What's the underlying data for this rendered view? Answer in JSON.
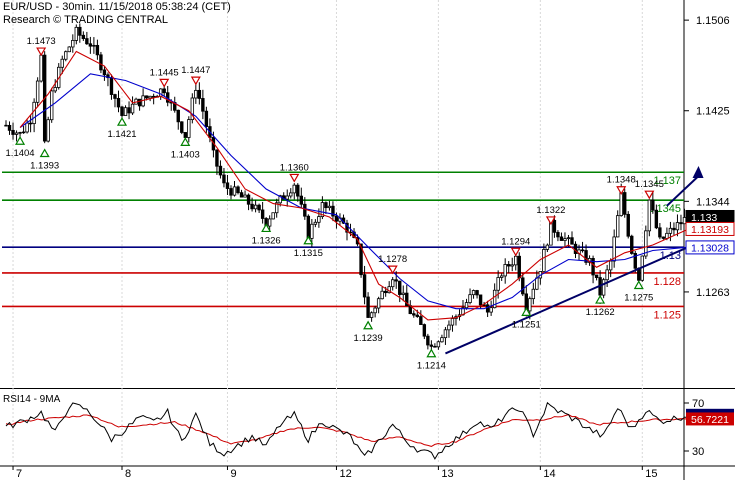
{
  "header": {
    "title": "EUR/USD - 30min. 11/15/2018 05:38:24 (CET)",
    "credit": "Research © TRADING CENTRAL"
  },
  "colors": {
    "price": "#000000",
    "ma_fast": "#cc0000",
    "ma_slow": "#0000cc",
    "resistance": "#008000",
    "pivot": "#000080",
    "support": "#cc0000",
    "trendline": "#000066",
    "rsi": "#000000",
    "rsi_ma": "#cc0000",
    "bullish_marker": "#008000",
    "bearish_marker": "#cc0000"
  },
  "chart_data": [
    {
      "type": "candlestick",
      "x_ticks": [
        {
          "label": "7",
          "idx": 2
        },
        {
          "label": "8",
          "idx": 33
        },
        {
          "label": "9",
          "idx": 63
        },
        {
          "label": "12",
          "idx": 94
        },
        {
          "label": "13",
          "idx": 123
        },
        {
          "label": "14",
          "idx": 152
        },
        {
          "label": "15",
          "idx": 181
        }
      ],
      "y_ticks": [
        1.1506,
        1.1425,
        1.1344,
        1.1263
      ],
      "ylim": [
        1.1178,
        1.1524
      ],
      "n_bars": 190,
      "price_path": [
        [
          0,
          1.1412
        ],
        [
          4,
          1.1404
        ],
        [
          7,
          1.1418
        ],
        [
          10,
          1.1473
        ],
        [
          11,
          1.1393
        ],
        [
          13,
          1.144
        ],
        [
          16,
          1.147
        ],
        [
          20,
          1.1495
        ],
        [
          24,
          1.1485
        ],
        [
          28,
          1.146
        ],
        [
          33,
          1.1421
        ],
        [
          37,
          1.1432
        ],
        [
          41,
          1.1438
        ],
        [
          45,
          1.1445
        ],
        [
          47,
          1.143
        ],
        [
          51,
          1.1403
        ],
        [
          54,
          1.1447
        ],
        [
          56,
          1.1425
        ],
        [
          59,
          1.1385
        ],
        [
          62,
          1.1358
        ],
        [
          66,
          1.135
        ],
        [
          70,
          1.134
        ],
        [
          74,
          1.1326
        ],
        [
          78,
          1.1345
        ],
        [
          82,
          1.136
        ],
        [
          86,
          1.1315
        ],
        [
          90,
          1.134
        ],
        [
          94,
          1.133
        ],
        [
          97,
          1.132
        ],
        [
          100,
          1.1302
        ],
        [
          103,
          1.1239
        ],
        [
          107,
          1.1262
        ],
        [
          110,
          1.1278
        ],
        [
          114,
          1.125
        ],
        [
          118,
          1.1232
        ],
        [
          121,
          1.1214
        ],
        [
          125,
          1.123
        ],
        [
          129,
          1.1245
        ],
        [
          133,
          1.1262
        ],
        [
          137,
          1.1245
        ],
        [
          141,
          1.128
        ],
        [
          145,
          1.1294
        ],
        [
          148,
          1.1251
        ],
        [
          152,
          1.1285
        ],
        [
          155,
          1.1322
        ],
        [
          159,
          1.131
        ],
        [
          163,
          1.1298
        ],
        [
          166,
          1.129
        ],
        [
          169,
          1.1262
        ],
        [
          172,
          1.129
        ],
        [
          175,
          1.1349
        ],
        [
          178,
          1.13
        ],
        [
          180,
          1.1275
        ],
        [
          183,
          1.1345
        ],
        [
          186,
          1.1308
        ],
        [
          190,
          1.132
        ],
        [
          194,
          1.133
        ]
      ],
      "ma_fast": [
        [
          4,
          1.141
        ],
        [
          12,
          1.144
        ],
        [
          20,
          1.1478
        ],
        [
          28,
          1.1465
        ],
        [
          36,
          1.1432
        ],
        [
          44,
          1.1438
        ],
        [
          52,
          1.1425
        ],
        [
          60,
          1.1392
        ],
        [
          68,
          1.1355
        ],
        [
          76,
          1.1342
        ],
        [
          84,
          1.1338
        ],
        [
          92,
          1.133
        ],
        [
          100,
          1.131
        ],
        [
          106,
          1.127
        ],
        [
          112,
          1.1258
        ],
        [
          120,
          1.1238
        ],
        [
          128,
          1.124
        ],
        [
          136,
          1.1252
        ],
        [
          144,
          1.127
        ],
        [
          152,
          1.1292
        ],
        [
          160,
          1.1305
        ],
        [
          168,
          1.1285
        ],
        [
          176,
          1.1298
        ],
        [
          184,
          1.1305
        ],
        [
          194,
          1.1319
        ]
      ],
      "ma_slow": [
        [
          4,
          1.141
        ],
        [
          14,
          1.1432
        ],
        [
          24,
          1.1458
        ],
        [
          34,
          1.1452
        ],
        [
          44,
          1.144
        ],
        [
          54,
          1.142
        ],
        [
          64,
          1.1385
        ],
        [
          74,
          1.1355
        ],
        [
          84,
          1.1338
        ],
        [
          94,
          1.1332
        ],
        [
          104,
          1.13
        ],
        [
          112,
          1.1275
        ],
        [
          120,
          1.1255
        ],
        [
          128,
          1.1248
        ],
        [
          136,
          1.1248
        ],
        [
          144,
          1.1258
        ],
        [
          152,
          1.1278
        ],
        [
          160,
          1.1292
        ],
        [
          168,
          1.129
        ],
        [
          176,
          1.1292
        ],
        [
          184,
          1.13
        ],
        [
          194,
          1.1303
        ]
      ],
      "levels": [
        {
          "value": 1.137,
          "label": "1.137",
          "kind": "resistance"
        },
        {
          "value": 1.1345,
          "label": "1.1345",
          "kind": "resistance"
        },
        {
          "value": 1.1303,
          "label": "1.13",
          "kind": "pivot"
        },
        {
          "value": 1.128,
          "label": "1.128",
          "kind": "support"
        },
        {
          "value": 1.125,
          "label": "1.125",
          "kind": "support"
        }
      ],
      "price_tags": [
        {
          "value": 1.133,
          "label": "1.133",
          "style": "current"
        },
        {
          "value": 1.13193,
          "label": "1.13193",
          "style": "ma_fast"
        },
        {
          "value": 1.13028,
          "label": "1.13028",
          "style": "ma_slow"
        }
      ],
      "swing_labels": [
        {
          "idx": 10,
          "value": 1.1473,
          "label": "1.1473",
          "marker": "bear"
        },
        {
          "idx": 4,
          "value": 1.1404,
          "label": "1.1404",
          "marker": "bull"
        },
        {
          "idx": 11,
          "value": 1.1393,
          "label": "1.1393",
          "marker": "bull"
        },
        {
          "idx": 33,
          "value": 1.1421,
          "label": "1.1421",
          "marker": "bull"
        },
        {
          "idx": 45,
          "value": 1.1445,
          "label": "1.1445",
          "marker": "bear"
        },
        {
          "idx": 54,
          "value": 1.1447,
          "label": "1.1447",
          "marker": "bear"
        },
        {
          "idx": 51,
          "value": 1.1403,
          "label": "1.1403",
          "marker": "bull"
        },
        {
          "idx": 82,
          "value": 1.136,
          "label": "1.1360",
          "marker": "bear"
        },
        {
          "idx": 74,
          "value": 1.1326,
          "label": "1.1326",
          "marker": "bull"
        },
        {
          "idx": 86,
          "value": 1.1315,
          "label": "1.1315",
          "marker": "bull"
        },
        {
          "idx": 110,
          "value": 1.1278,
          "label": "1.1278",
          "marker": "bear"
        },
        {
          "idx": 103,
          "value": 1.1239,
          "label": "1.1239",
          "marker": "bull"
        },
        {
          "idx": 121,
          "value": 1.1214,
          "label": "1.1214",
          "marker": "bull"
        },
        {
          "idx": 145,
          "value": 1.1294,
          "label": "1.1294",
          "marker": "bear"
        },
        {
          "idx": 155,
          "value": 1.1322,
          "label": "1.1322",
          "marker": "bear"
        },
        {
          "idx": 148,
          "value": 1.1251,
          "label": "1.1251",
          "marker": "bull"
        },
        {
          "idx": 175,
          "value": 1.1349,
          "label": "1.1348",
          "marker": "bear"
        },
        {
          "idx": 183,
          "value": 1.1345,
          "label": "1.1345",
          "marker": "bear"
        },
        {
          "idx": 169,
          "value": 1.1262,
          "label": "1.1262",
          "marker": "bull"
        },
        {
          "idx": 180,
          "value": 1.1275,
          "label": "1.1275",
          "marker": "bull"
        }
      ],
      "trendline": [
        [
          125,
          1.1208
        ],
        [
          194,
          1.1303
        ]
      ],
      "forecast_arrow": [
        [
          188,
          1.134
        ],
        [
          197,
          1.1372
        ]
      ]
    },
    {
      "type": "line",
      "title": "RSI14 - 9MA",
      "ylim": [
        20,
        80
      ],
      "y_ticks": [
        30,
        70
      ],
      "tags": [
        {
          "value": 59.7452,
          "label": "59.7452",
          "style": "rsi"
        },
        {
          "value": 56.7221,
          "label": "56.7221",
          "style": "rsi_ma"
        }
      ],
      "rsi": [
        [
          0,
          50
        ],
        [
          5,
          55
        ],
        [
          10,
          62
        ],
        [
          14,
          45
        ],
        [
          18,
          68
        ],
        [
          22,
          66
        ],
        [
          26,
          55
        ],
        [
          30,
          40
        ],
        [
          34,
          48
        ],
        [
          38,
          58
        ],
        [
          42,
          54
        ],
        [
          46,
          62
        ],
        [
          50,
          38
        ],
        [
          54,
          60
        ],
        [
          58,
          36
        ],
        [
          62,
          28
        ],
        [
          66,
          35
        ],
        [
          70,
          42
        ],
        [
          74,
          34
        ],
        [
          78,
          52
        ],
        [
          82,
          60
        ],
        [
          86,
          40
        ],
        [
          90,
          55
        ],
        [
          94,
          48
        ],
        [
          98,
          42
        ],
        [
          102,
          24
        ],
        [
          106,
          38
        ],
        [
          110,
          52
        ],
        [
          114,
          38
        ],
        [
          118,
          30
        ],
        [
          122,
          26
        ],
        [
          126,
          36
        ],
        [
          130,
          44
        ],
        [
          134,
          55
        ],
        [
          138,
          48
        ],
        [
          142,
          60
        ],
        [
          146,
          66
        ],
        [
          150,
          44
        ],
        [
          154,
          68
        ],
        [
          158,
          62
        ],
        [
          162,
          56
        ],
        [
          166,
          48
        ],
        [
          170,
          42
        ],
        [
          174,
          66
        ],
        [
          178,
          48
        ],
        [
          182,
          64
        ],
        [
          186,
          55
        ],
        [
          190,
          57
        ],
        [
          194,
          60
        ]
      ],
      "rsi_ma": [
        [
          0,
          52
        ],
        [
          8,
          56
        ],
        [
          16,
          58
        ],
        [
          24,
          60
        ],
        [
          32,
          50
        ],
        [
          40,
          52
        ],
        [
          48,
          54
        ],
        [
          56,
          46
        ],
        [
          64,
          36
        ],
        [
          72,
          40
        ],
        [
          80,
          48
        ],
        [
          88,
          50
        ],
        [
          96,
          46
        ],
        [
          104,
          38
        ],
        [
          112,
          42
        ],
        [
          120,
          34
        ],
        [
          128,
          38
        ],
        [
          136,
          48
        ],
        [
          144,
          56
        ],
        [
          152,
          56
        ],
        [
          160,
          60
        ],
        [
          168,
          52
        ],
        [
          176,
          54
        ],
        [
          184,
          56
        ],
        [
          194,
          57
        ]
      ]
    }
  ]
}
